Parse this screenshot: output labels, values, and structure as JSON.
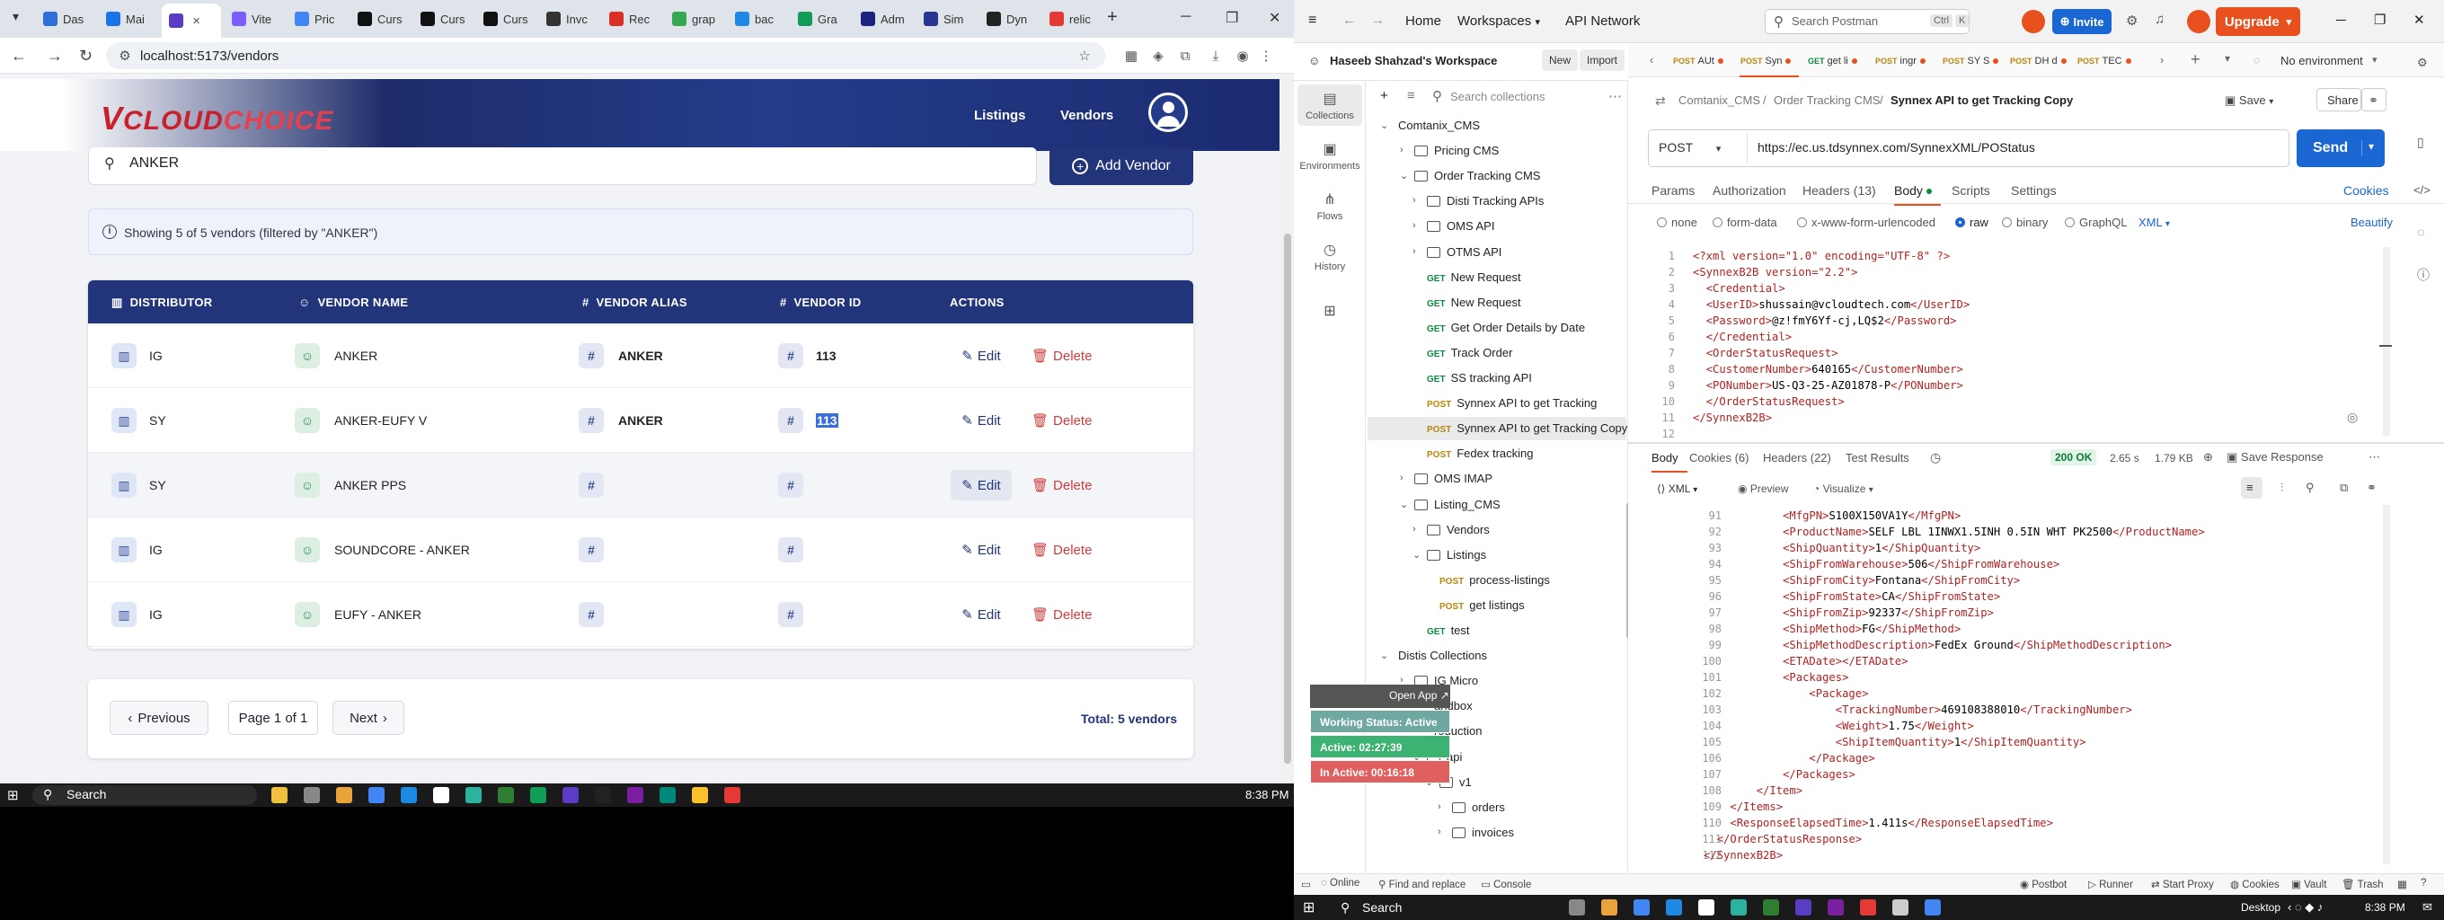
{
  "browser": {
    "tabs": [
      "Das",
      "Mai",
      "",
      "Vite",
      "Pric",
      "Curs",
      "Curs",
      "Curs",
      "Invc",
      "Rec",
      "grap",
      "bac",
      "Gra",
      "Adm",
      "Sim",
      "Dyn",
      "relic"
    ],
    "url": "localhost:5173/vendors",
    "colors": {
      "accent": "#22347a",
      "danger": "#d23b3b"
    }
  },
  "app": {
    "logo": {
      "v": "V",
      "cloud": "CLOUD",
      "choice": "CHOICE"
    },
    "nav": {
      "listings": "Listings",
      "vendors": "Vendors"
    },
    "search_value": "ANKER",
    "add_vendor": "Add Vendor",
    "info": "Showing 5 of 5 vendors (filtered by \"ANKER\")",
    "headers": {
      "distributor": "DISTRIBUTOR",
      "vendor_name": "VENDOR NAME",
      "vendor_alias": "VENDOR ALIAS",
      "vendor_id": "VENDOR ID",
      "actions": "ACTIONS"
    },
    "rows": [
      {
        "dist": "IG",
        "name": "ANKER",
        "alias": "ANKER",
        "id": "113"
      },
      {
        "dist": "SY",
        "name": "ANKER-EUFY V",
        "alias": "ANKER",
        "id": "113"
      },
      {
        "dist": "SY",
        "name": "ANKER PPS",
        "alias": "",
        "id": ""
      },
      {
        "dist": "IG",
        "name": "SOUNDCORE - ANKER",
        "alias": "",
        "id": ""
      },
      {
        "dist": "IG",
        "name": "EUFY - ANKER",
        "alias": "",
        "id": ""
      }
    ],
    "edit": "Edit",
    "delete": "Delete",
    "pagination": {
      "prev": "Previous",
      "page": "Page 1 of 1",
      "next": "Next",
      "total": "Total: 5 vendors"
    }
  },
  "taskbar_left": {
    "search": "Search",
    "time": "8:38 PM"
  },
  "taskbar_right": {
    "search": "Search",
    "desktop": "Desktop",
    "time": "8:38 PM"
  },
  "postman": {
    "nav": {
      "home": "Home",
      "workspaces": "Workspaces",
      "api_network": "API Network"
    },
    "search_placeholder": "Search Postman",
    "shortcut": [
      "Ctrl",
      "K"
    ],
    "invite": "Invite",
    "upgrade": "Upgrade",
    "workspace": "Haseeb Shahzad's Workspace",
    "new": "New",
    "import": "Import",
    "rail": [
      "Collections",
      "Environments",
      "Flows",
      "History"
    ],
    "search_collections": "Search collections",
    "tree": [
      "Comtanix_CMS",
      "Pricing CMS",
      "Order Tracking CMS",
      "Disti Tracking APIs",
      "OMS API",
      "OTMS API",
      "New Request",
      "New Request",
      "Get Order Details by Date",
      "Track Order",
      "SS tracking API",
      "Synnex API to get Tracking",
      "Synnex API to get Tracking Copy",
      "Fedex tracking",
      "OMS IMAP",
      "Listing_CMS",
      "Vendors",
      "Listings",
      "process-listings",
      "get listings",
      "test",
      "Distis Collections",
      "IG Micro",
      "andbox",
      "roduction",
      "api",
      "v1",
      "orders",
      "invoices"
    ],
    "methods": {
      "get": "GET",
      "post": "POST"
    },
    "overlay": {
      "open_app": "Open App ↗",
      "working": "Working Status: Active",
      "active": "Active: 02:27:39",
      "inactive": "In Active: 00:16:18"
    },
    "req_tabs": [
      "AUt",
      "Syn",
      "get li",
      "ingr",
      "SY S",
      "DH d",
      "TEC"
    ],
    "no_env": "No environment",
    "breadcrumb": [
      "Comtanix_CMS",
      "Order Tracking CMS",
      "Synnex API to get Tracking Copy"
    ],
    "save": "Save",
    "share": "Share",
    "method": "POST",
    "request_url": "https://ec.us.tdsynnex.com/SynnexXML/POStatus",
    "send": "Send",
    "req_subtabs": {
      "params": "Params",
      "authorization": "Authorization",
      "headers": "Headers (13)",
      "body": "Body",
      "scripts": "Scripts",
      "settings": "Settings",
      "cookies": "Cookies"
    },
    "body_types": {
      "none": "none",
      "form_data": "form-data",
      "urlencoded": "x-www-form-urlencoded",
      "raw": "raw",
      "binary": "binary",
      "graphql": "GraphQL",
      "xml": "XML",
      "beautify": "Beautify"
    },
    "request_body": [
      {
        "n": "1",
        "t": "<?xml version=\"1.0\" encoding=\"UTF-8\" ?>"
      },
      {
        "n": "2",
        "t": "<SynnexB2B version=\"2.2\">"
      },
      {
        "n": "3",
        "t": "  <Credential>"
      },
      {
        "n": "4",
        "t": "  <UserID>shussain@vcloudtech.com</UserID>"
      },
      {
        "n": "5",
        "t": "  <Password>@z!fmY6Yf-cj,LQ$2</Password>"
      },
      {
        "n": "6",
        "t": "  </Credential>"
      },
      {
        "n": "7",
        "t": "  <OrderStatusRequest>"
      },
      {
        "n": "8",
        "t": "  <CustomerNumber>640165</CustomerNumber>"
      },
      {
        "n": "9",
        "t": "  <PONumber>US-Q3-25-AZ01878-P</PONumber>"
      },
      {
        "n": "10",
        "t": "  </OrderStatusRequest>"
      },
      {
        "n": "11",
        "t": "</SynnexB2B>"
      },
      {
        "n": "12",
        "t": ""
      }
    ],
    "resp_tabs": {
      "body": "Body",
      "cookies": "Cookies (6)",
      "headers": "Headers (22)",
      "tests": "Test Results"
    },
    "resp_status": {
      "code": "200 OK",
      "time": "2.65 s",
      "size": "1.79 KB",
      "save": "Save Response"
    },
    "resp_view": {
      "xml": "XML",
      "preview": "Preview",
      "visualize": "Visualize"
    },
    "response_body": [
      {
        "n": "91",
        "t": "            <MfgPN>S100X150VA1Y</MfgPN>"
      },
      {
        "n": "92",
        "t": "            <ProductName>SELF LBL 1INWX1.5INH 0.5IN WHT PK2500</ProductName>"
      },
      {
        "n": "93",
        "t": "            <ShipQuantity>1</ShipQuantity>"
      },
      {
        "n": "94",
        "t": "            <ShipFromWarehouse>506</ShipFromWarehouse>"
      },
      {
        "n": "95",
        "t": "            <ShipFromCity>Fontana</ShipFromCity>"
      },
      {
        "n": "96",
        "t": "            <ShipFromState>CA</ShipFromState>"
      },
      {
        "n": "97",
        "t": "            <ShipFromZip>92337</ShipFromZip>"
      },
      {
        "n": "98",
        "t": "            <ShipMethod>FG</ShipMethod>"
      },
      {
        "n": "99",
        "t": "            <ShipMethodDescription>FedEx Ground</ShipMethodDescription>"
      },
      {
        "n": "100",
        "t": "            <ETADate></ETADate>"
      },
      {
        "n": "101",
        "t": "            <Packages>"
      },
      {
        "n": "102",
        "t": "                <Package>"
      },
      {
        "n": "103",
        "t": "                    <TrackingNumber>469108388010</TrackingNumber>"
      },
      {
        "n": "104",
        "t": "                    <Weight>1.75</Weight>"
      },
      {
        "n": "105",
        "t": "                    <ShipItemQuantity>1</ShipItemQuantity>"
      },
      {
        "n": "106",
        "t": "                </Package>"
      },
      {
        "n": "107",
        "t": "            </Packages>"
      },
      {
        "n": "108",
        "t": "        </Item>"
      },
      {
        "n": "109",
        "t": "    </Items>"
      },
      {
        "n": "110",
        "t": "    <ResponseElapsedTime>1.411s</ResponseElapsedTime>"
      },
      {
        "n": "111",
        "t": "  </OrderStatusResponse>"
      },
      {
        "n": "112",
        "t": "</SynnexB2B>"
      }
    ],
    "status_bar": {
      "online": "Online",
      "find": "Find and replace",
      "console": "Console",
      "postbot": "Postbot",
      "runner": "Runner",
      "proxy": "Start Proxy",
      "cookies": "Cookies",
      "vault": "Vault",
      "trash": "Trash"
    }
  }
}
